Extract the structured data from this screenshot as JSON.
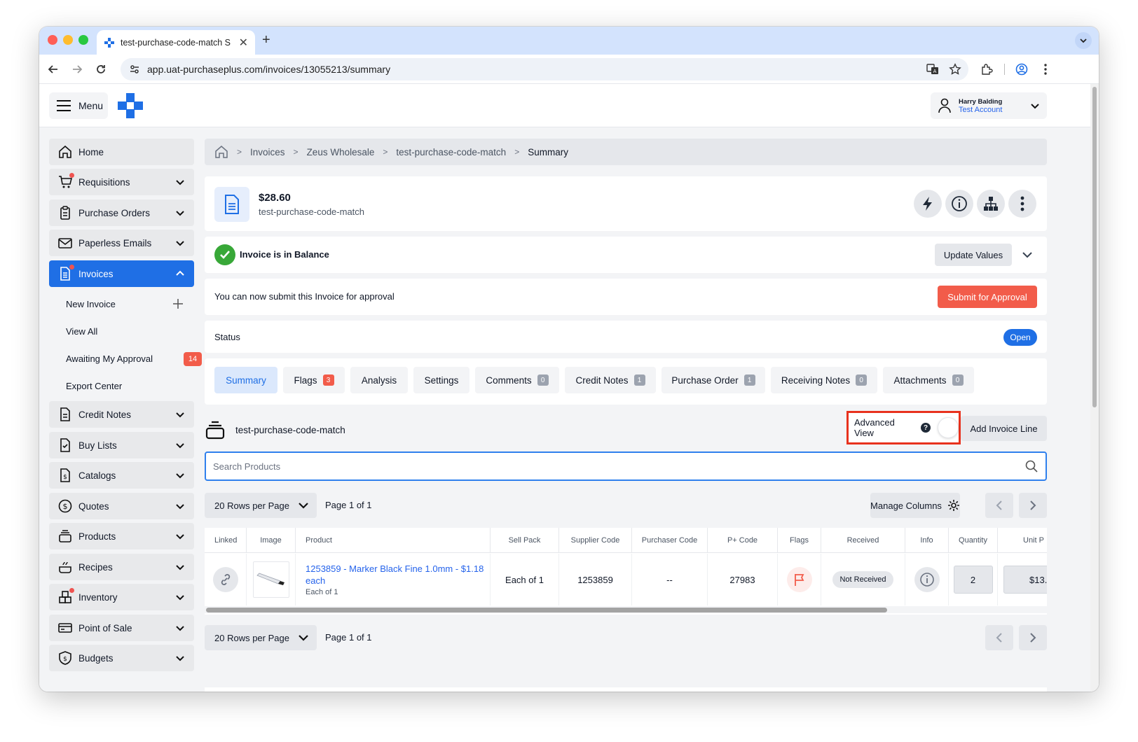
{
  "browser": {
    "tab_title": "test-purchase-code-match S",
    "url": "app.uat-purchaseplus.com/invoices/13055213/summary"
  },
  "topbar": {
    "menu_label": "Menu",
    "user_name": "Harry Balding",
    "user_account": "Test Account"
  },
  "sidebar": {
    "items": [
      {
        "label": "Home",
        "icon": "home-icon"
      },
      {
        "label": "Requisitions",
        "icon": "cart-icon"
      },
      {
        "label": "Purchase Orders",
        "icon": "clipboard-icon"
      },
      {
        "label": "Paperless Emails",
        "icon": "mail-icon"
      },
      {
        "label": "Invoices",
        "icon": "invoice-icon"
      },
      {
        "label": "Credit Notes",
        "icon": "document-icon"
      },
      {
        "label": "Buy Lists",
        "icon": "checklist-icon"
      },
      {
        "label": "Catalogs",
        "icon": "price-tag-icon"
      },
      {
        "label": "Quotes",
        "icon": "dollar-circle-icon"
      },
      {
        "label": "Products",
        "icon": "stack-icon"
      },
      {
        "label": "Recipes",
        "icon": "cooking-pot-icon"
      },
      {
        "label": "Inventory",
        "icon": "boxes-icon"
      },
      {
        "label": "Point of Sale",
        "icon": "register-icon"
      },
      {
        "label": "Budgets",
        "icon": "shield-dollar-icon"
      }
    ],
    "sub_items": [
      {
        "label": "New Invoice"
      },
      {
        "label": "View All"
      },
      {
        "label": "Awaiting My Approval",
        "badge": "14"
      },
      {
        "label": "Export Center"
      }
    ]
  },
  "breadcrumb": [
    "Invoices",
    "Zeus Wholesale",
    "test-purchase-code-match",
    "Summary"
  ],
  "invoice": {
    "amount": "$28.60",
    "reference": "test-purchase-code-match",
    "balance_text": "Invoice is in Balance",
    "update_values": "Update Values",
    "submit_text": "You can now submit this Invoice for approval",
    "submit_button": "Submit for Approval",
    "status_label": "Status",
    "status_value": "Open"
  },
  "tabs": [
    {
      "label": "Summary"
    },
    {
      "label": "Flags",
      "count": "3"
    },
    {
      "label": "Analysis"
    },
    {
      "label": "Settings"
    },
    {
      "label": "Comments",
      "count": "0"
    },
    {
      "label": "Credit Notes",
      "count": "1"
    },
    {
      "label": "Purchase Order",
      "count": "1"
    },
    {
      "label": "Receiving Notes",
      "count": "0"
    },
    {
      "label": "Attachments",
      "count": "0"
    }
  ],
  "lines": {
    "title": "test-purchase-code-match",
    "advanced_view": "Advanced View",
    "add_line": "Add Invoice Line",
    "search_placeholder": "Search Products",
    "rows_per_page": "20 Rows per Page",
    "page_info": "Page 1 of 1",
    "manage_columns": "Manage Columns"
  },
  "table": {
    "headers": [
      "Linked",
      "Image",
      "Product",
      "Sell Pack",
      "Supplier Code",
      "Purchaser Code",
      "P+ Code",
      "Flags",
      "Received",
      "Info",
      "Quantity",
      "Unit P"
    ],
    "row": {
      "product_name": "1253859 - Marker Black Fine 1.0mm - $1.18 each",
      "product_pack": "Each of 1",
      "sell_pack": "Each of 1",
      "supplier_code": "1253859",
      "purchaser_code": "--",
      "pplus_code": "27983",
      "received": "Not Received",
      "quantity": "2",
      "unit_price": "$13."
    }
  },
  "colors": {
    "primary": "#1f6fe5",
    "danger": "#f25c4a",
    "success": "#38a838",
    "highlight_border": "#e8321e"
  }
}
